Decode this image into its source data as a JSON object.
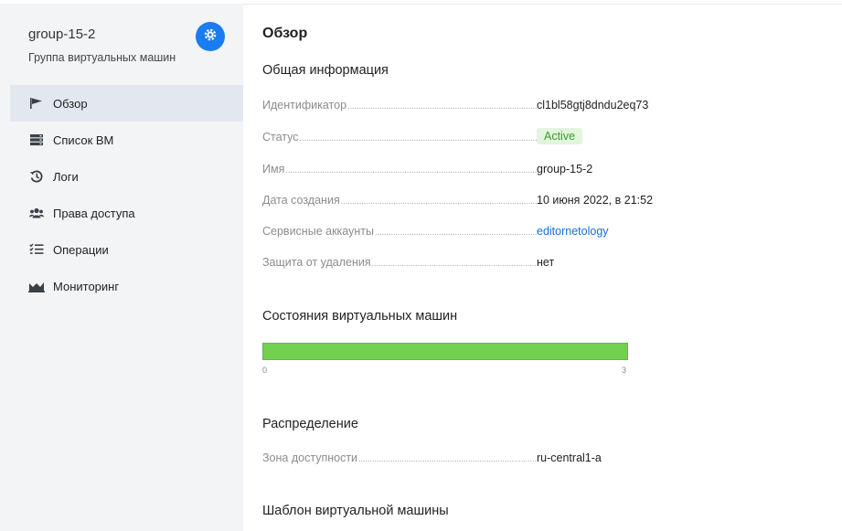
{
  "sidebar": {
    "title": "group-15-2",
    "subtitle": "Группа виртуальных машин",
    "settings_icon": "gear-icon",
    "items": [
      {
        "label": "Обзор",
        "icon": "flag-icon",
        "active": true
      },
      {
        "label": "Список ВМ",
        "icon": "server-list-icon",
        "active": false
      },
      {
        "label": "Логи",
        "icon": "history-icon",
        "active": false
      },
      {
        "label": "Права доступа",
        "icon": "users-icon",
        "active": false
      },
      {
        "label": "Операции",
        "icon": "checklist-icon",
        "active": false
      },
      {
        "label": "Мониторинг",
        "icon": "area-chart-icon",
        "active": false
      }
    ]
  },
  "main": {
    "title": "Обзор",
    "general": {
      "title": "Общая информация",
      "rows": [
        {
          "label": "Идентификатор",
          "value": "cl1bl58gtj8dndu2eq73"
        },
        {
          "label": "Статус",
          "value": "Active"
        },
        {
          "label": "Имя",
          "value": "group-15-2"
        },
        {
          "label": "Дата создания",
          "value": "10 июня 2022, в 21:52"
        },
        {
          "label": "Сервисные аккаунты",
          "value": "editornetology"
        },
        {
          "label": "Защита от удаления",
          "value": "нет"
        }
      ]
    },
    "vm_states": {
      "title": "Состояния виртуальных машин",
      "min": "0",
      "max": "3",
      "running": 3,
      "total": 3
    },
    "distribution": {
      "title": "Распределение",
      "rows": [
        {
          "label": "Зона доступности",
          "value": "ru-central1-a"
        }
      ]
    },
    "template": {
      "title": "Шаблон виртуальной машины"
    }
  },
  "colors": {
    "accent": "#1a7cf0",
    "link": "#1a6fd6",
    "status_active_bg": "#e2f5dd",
    "status_active_text": "#3b9c2e",
    "bar_fill": "#72d04f"
  }
}
